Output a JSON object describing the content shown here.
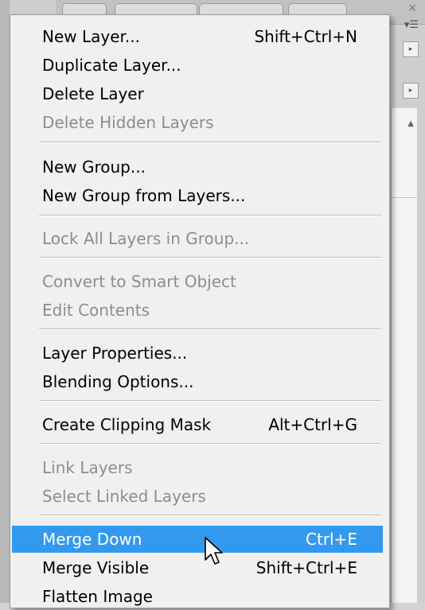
{
  "menu": {
    "items": [
      {
        "label": "New Layer...",
        "shortcut": "Shift+Ctrl+N"
      },
      {
        "label": "Duplicate Layer...",
        "shortcut": ""
      },
      {
        "label": "Delete Layer",
        "shortcut": ""
      },
      {
        "label": "Delete Hidden Layers",
        "shortcut": ""
      },
      {
        "label": "New Group...",
        "shortcut": ""
      },
      {
        "label": "New Group from Layers...",
        "shortcut": ""
      },
      {
        "label": "Lock All Layers in Group...",
        "shortcut": ""
      },
      {
        "label": "Convert to Smart Object",
        "shortcut": ""
      },
      {
        "label": "Edit Contents",
        "shortcut": ""
      },
      {
        "label": "Layer Properties...",
        "shortcut": ""
      },
      {
        "label": "Blending Options...",
        "shortcut": ""
      },
      {
        "label": "Create Clipping Mask",
        "shortcut": "Alt+Ctrl+G"
      },
      {
        "label": "Link Layers",
        "shortcut": ""
      },
      {
        "label": "Select Linked Layers",
        "shortcut": ""
      },
      {
        "label": "Merge Down",
        "shortcut": "Ctrl+E"
      },
      {
        "label": "Merge Visible",
        "shortcut": "Shift+Ctrl+E"
      },
      {
        "label": "Flatten Image",
        "shortcut": ""
      }
    ]
  },
  "background": {
    "icons": [
      "close-icon",
      "panel-menu-icon",
      "stepper-arrow-icon",
      "scroll-up-arrow-icon"
    ]
  },
  "colors": {
    "highlight": "#3399ef",
    "disabled_text": "#8d8d8d",
    "menu_bg": "#f0f0f0",
    "layer_selection": "#3d8ee8"
  }
}
